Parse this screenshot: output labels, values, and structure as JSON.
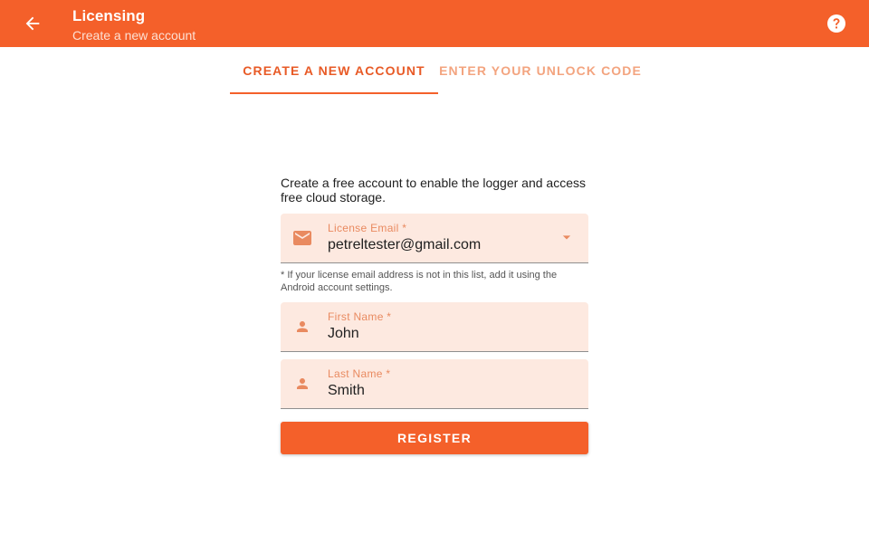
{
  "app_bar": {
    "back_icon": "arrow-back-icon",
    "title": "Licensing",
    "subtitle": "Create a new account",
    "help_icon": "help-circle-icon"
  },
  "tabs": [
    {
      "label": "CREATE A NEW ACCOUNT",
      "selected": true
    },
    {
      "label": "ENTER YOUR UNLOCK CODE",
      "selected": false
    }
  ],
  "form": {
    "intro": "Create a free account to enable the logger and access free cloud storage.",
    "email": {
      "icon": "email-icon",
      "label": "License Email *",
      "value": "petreltester@gmail.com"
    },
    "email_hint": "* If your license email address is not in this list, add it using the Android account settings.",
    "first_name": {
      "icon": "person-icon",
      "label": "First Name *",
      "value": "John"
    },
    "last_name": {
      "icon": "person-icon",
      "label": "Last Name *",
      "value": "Smith"
    },
    "register_label": "REGISTER"
  },
  "colors": {
    "primary": "#f4602a",
    "field_background": "#fde9e0",
    "field_label": "#e98a60",
    "inactive_tab": "#f3a47f"
  }
}
